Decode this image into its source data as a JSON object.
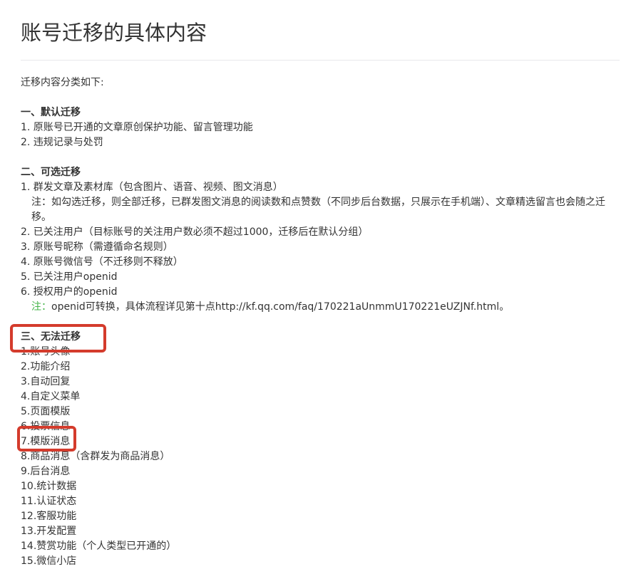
{
  "page": {
    "title": "账号迁移的具体内容"
  },
  "intro": "迁移内容分类如下:",
  "sections": {
    "default": {
      "heading": "一、默认迁移",
      "items": [
        "1. 原账号已开通的文章原创保护功能、留言管理功能",
        "2. 违规记录与处罚"
      ]
    },
    "optional": {
      "heading": "二、可选迁移",
      "item1": "1. 群发文章及素材库（包含图片、语音、视频、图文消息）",
      "note1": "注：如勾选迁移，则全部迁移，已群发图文消息的阅读数和点赞数（不同步后台数据，只展示在手机端）、文章精选留言也会随之迁移。",
      "items": [
        "2. 已关注用户（目标账号的关注用户数必须不超过1000，迁移后在默认分组）",
        "3. 原账号昵称（需遵循命名规则）",
        "4. 原账号微信号（不迁移则不释放）",
        "5. 已关注用户openid",
        "6. 授权用户的openid"
      ],
      "note2_label": "注：",
      "note2_text": "openid可转换，具体流程详见第十点http://kf.qq.com/faq/170221aUnmmU170221eUZJNf.html。"
    },
    "none": {
      "heading": "三、无法迁移",
      "items": [
        "1.账号头像",
        "2.功能介绍",
        "3.自动回复",
        "4.自定义菜单",
        "5.页面模版",
        "6.投票信息",
        "7.模版消息",
        "8.商品消息（含群发为商品消息）",
        "9.后台消息",
        "10.统计数据",
        "11.认证状态",
        "12.客服功能",
        "13.开发配置",
        "14.赞赏功能（个人类型已开通的）",
        "15.微信小店"
      ]
    }
  },
  "colors": {
    "highlight": "#d43b2c",
    "note_green": "#44b549",
    "text": "#333333"
  }
}
